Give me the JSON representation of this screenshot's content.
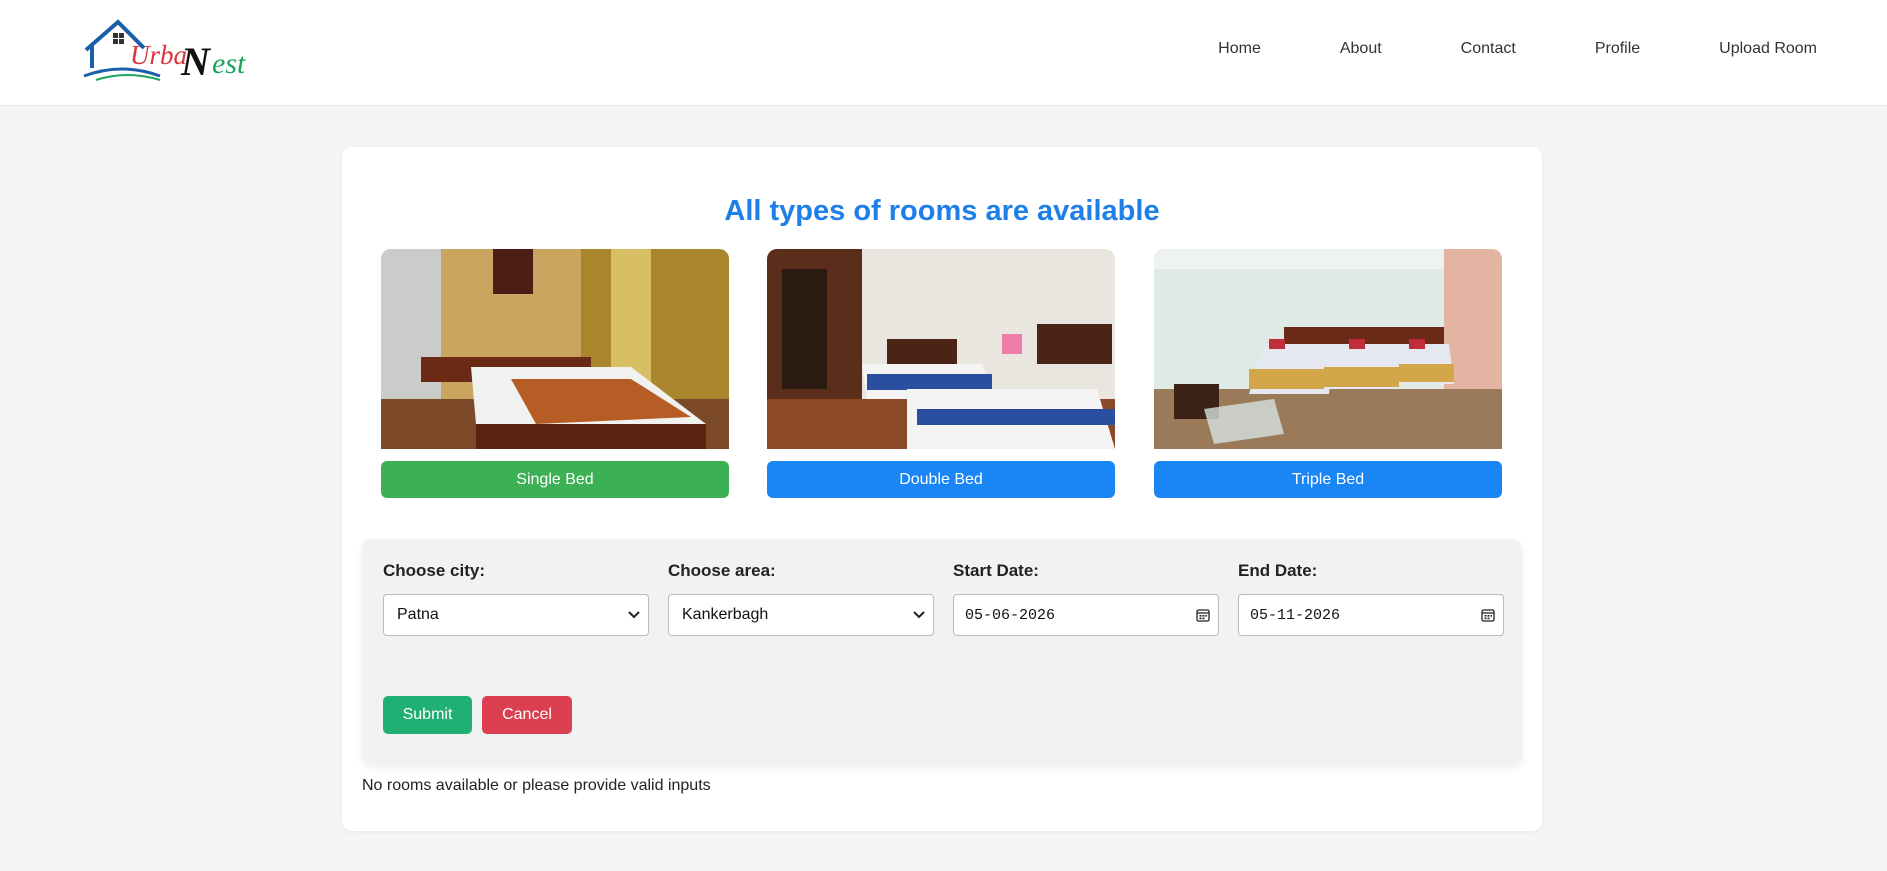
{
  "brand": {
    "part1": "Urba",
    "part2": "N",
    "part3": "est"
  },
  "nav": [
    "Home",
    "About",
    "Contact",
    "Profile",
    "Upload Room"
  ],
  "heading": "All types of rooms are available",
  "rooms": [
    {
      "label": "Single Bed",
      "color": "#3cb054"
    },
    {
      "label": "Double Bed",
      "color": "#1a85f5"
    },
    {
      "label": "Triple Bed",
      "color": "#1a85f5"
    }
  ],
  "form": {
    "city_label": "Choose city:",
    "city_value": "Patna",
    "area_label": "Choose area:",
    "area_value": "Kankerbagh",
    "start_label": "Start Date:",
    "start_value": "05-06-2026",
    "end_label": "End Date:",
    "end_value": "05-11-2026",
    "submit": "Submit",
    "cancel": "Cancel"
  },
  "colors": {
    "accent": "#1e7fe8",
    "submit": "#21b073",
    "cancel": "#dc3f4f"
  },
  "status": "No rooms available or please provide valid inputs"
}
